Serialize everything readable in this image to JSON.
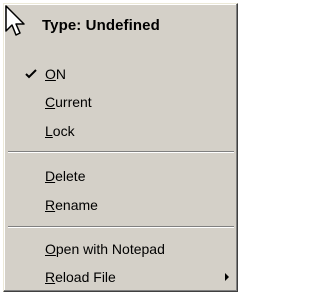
{
  "menu": {
    "title": "Type: Undefined",
    "items": [
      {
        "label": "ON",
        "mnemonic": "O",
        "rest": "N",
        "checked": true
      },
      {
        "label": "Current",
        "mnemonic": "C",
        "rest": "urrent"
      },
      {
        "label": "Lock",
        "mnemonic": "L",
        "rest": "ock"
      },
      {
        "label": "Delete",
        "mnemonic": "D",
        "rest": "elete"
      },
      {
        "label": "Rename",
        "mnemonic": "R",
        "rest": "ename"
      },
      {
        "label": "Open with Notepad",
        "mnemonic": "O",
        "rest": "pen with Notepad"
      },
      {
        "label": "Reload File",
        "mnemonic": "R",
        "rest": "eload File",
        "has_submenu": true
      }
    ]
  },
  "icons": {
    "cursor": "arrow-pointer-icon",
    "check": "checkmark-icon",
    "submenu": "submenu-arrow-icon"
  },
  "colors": {
    "menu_background": "#d4d0c8",
    "text": "#000000"
  }
}
